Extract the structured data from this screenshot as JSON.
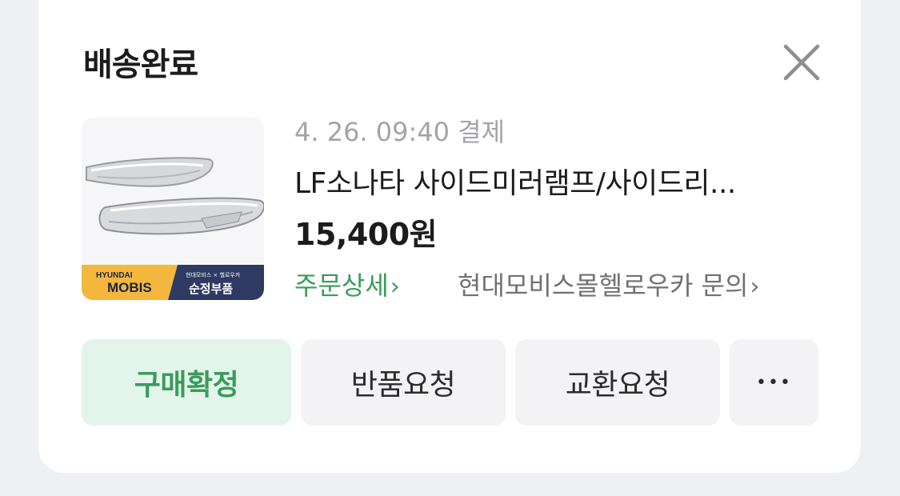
{
  "header": {
    "status_title": "배송완료",
    "close_icon": "close-icon"
  },
  "product": {
    "order_date": "4. 26. 09:40 결제",
    "name": "LF소나타 사이드미러램프/사이드리...",
    "price": "15,400원",
    "thumbnail": {
      "brand_line1": "HYUNDAI",
      "brand_line2": "MOBIS",
      "small_text": "현대모비스 × 헬로우카",
      "tag": "순정부품"
    }
  },
  "links": {
    "order_detail": "주문상세",
    "seller_inquiry": "현대모비스몰헬로우카 문의",
    "chevron": "›"
  },
  "actions": {
    "confirm": "구매확정",
    "return": "반품요청",
    "exchange": "교환요청",
    "more": "•••"
  },
  "colors": {
    "accent_green": "#3a9b5c",
    "confirm_bg": "#e3f5ea",
    "secondary_bg": "#f3f3f6",
    "page_bg": "#eff0f4"
  }
}
